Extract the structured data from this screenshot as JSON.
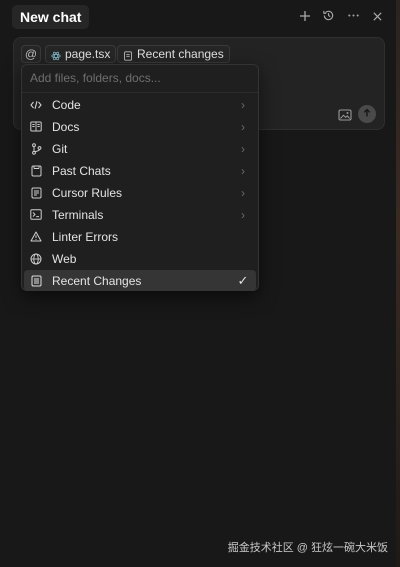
{
  "header": {
    "tab_title": "New chat",
    "icons": [
      "plus-icon",
      "history-icon",
      "more-icon",
      "close-icon"
    ]
  },
  "composer": {
    "at_symbol": "@",
    "file_chip": "page.tsx",
    "recent_chip": "Recent changes"
  },
  "menu": {
    "search_placeholder": "Add files, folders, docs...",
    "items": [
      {
        "label": "Code",
        "icon": "code-icon",
        "submenu": true
      },
      {
        "label": "Docs",
        "icon": "docs-icon",
        "submenu": true
      },
      {
        "label": "Git",
        "icon": "git-icon",
        "submenu": true
      },
      {
        "label": "Past Chats",
        "icon": "past-chats-icon",
        "submenu": true
      },
      {
        "label": "Cursor Rules",
        "icon": "cursor-rules-icon",
        "submenu": true
      },
      {
        "label": "Terminals",
        "icon": "terminal-icon",
        "submenu": true
      },
      {
        "label": "Linter Errors",
        "icon": "warning-icon",
        "submenu": false
      },
      {
        "label": "Web",
        "icon": "globe-icon",
        "submenu": false
      },
      {
        "label": "Recent Changes",
        "icon": "recent-changes-icon",
        "submenu": false,
        "selected": true
      }
    ]
  },
  "watermark": "掘金技术社区 @ 狂炫一碗大米饭",
  "colors": {
    "background": "#181818",
    "composer": "#232323",
    "menu": "#1f1f1f",
    "selected": "#353535"
  }
}
